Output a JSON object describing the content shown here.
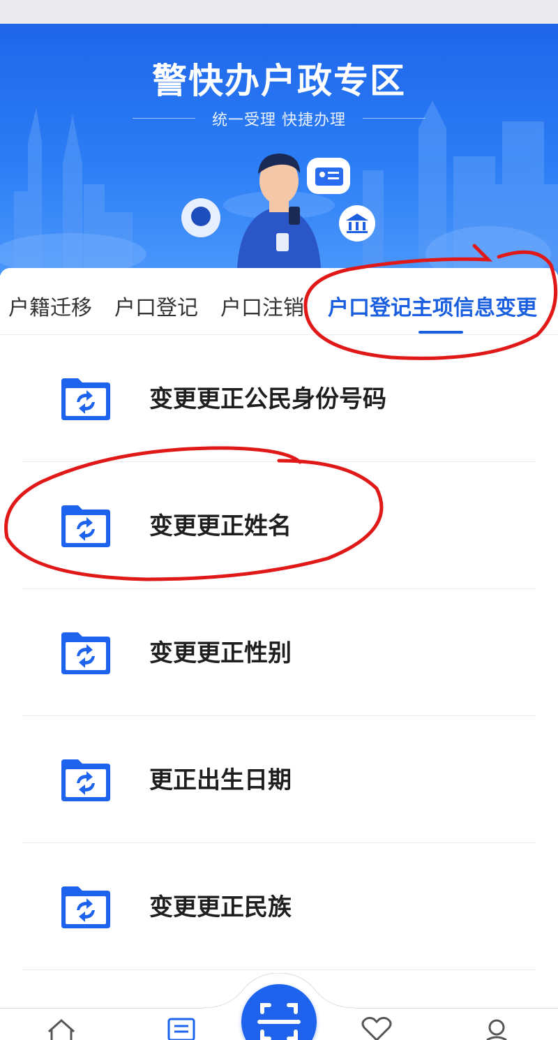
{
  "banner": {
    "title": "警快办户政专区",
    "subtitle": "统一受理   快捷办理"
  },
  "tabs": [
    {
      "label": "户籍迁移",
      "active": false
    },
    {
      "label": "户口登记",
      "active": false
    },
    {
      "label": "户口注销",
      "active": false
    },
    {
      "label": "户口登记主项信息变更",
      "active": true
    }
  ],
  "items": [
    {
      "label": "变更更正公民身份号码",
      "icon": "folder-refresh-icon"
    },
    {
      "label": "变更更正姓名",
      "icon": "folder-refresh-icon"
    },
    {
      "label": "变更更正性别",
      "icon": "folder-refresh-icon"
    },
    {
      "label": "更正出生日期",
      "icon": "folder-refresh-icon"
    },
    {
      "label": "变更更正民族",
      "icon": "folder-refresh-icon"
    }
  ],
  "bottom_nav": {
    "items": [
      "home-icon",
      "list-icon",
      "scan-icon",
      "heart-icon",
      "user-icon"
    ]
  },
  "colors": {
    "primary": "#1d63ee",
    "annotation": "#e01818"
  }
}
